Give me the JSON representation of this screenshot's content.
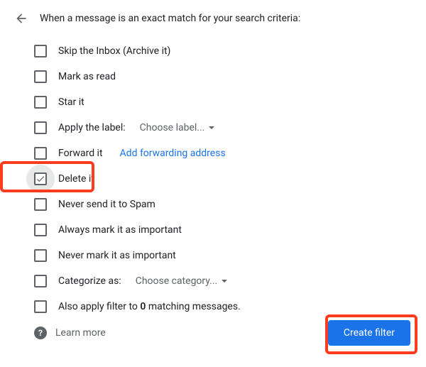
{
  "header": {
    "title": "When a message is an exact match for your search criteria:"
  },
  "options": {
    "skip_inbox": "Skip the Inbox (Archive it)",
    "mark_read": "Mark as read",
    "star_it": "Star it",
    "apply_label": "Apply the label:",
    "apply_label_dropdown": "Choose label...",
    "forward_it": "Forward it",
    "forward_link": "Add forwarding address",
    "delete_it": "Delete it",
    "never_spam": "Never send it to Spam",
    "always_important": "Always mark it as important",
    "never_important": "Never mark it as important",
    "categorize_as": "Categorize as:",
    "categorize_dropdown": "Choose category...",
    "also_apply_prefix": "Also apply filter to ",
    "also_apply_count": "0",
    "also_apply_suffix": " matching messages."
  },
  "footer": {
    "learn_more": "Learn more",
    "create_filter": "Create filter"
  }
}
